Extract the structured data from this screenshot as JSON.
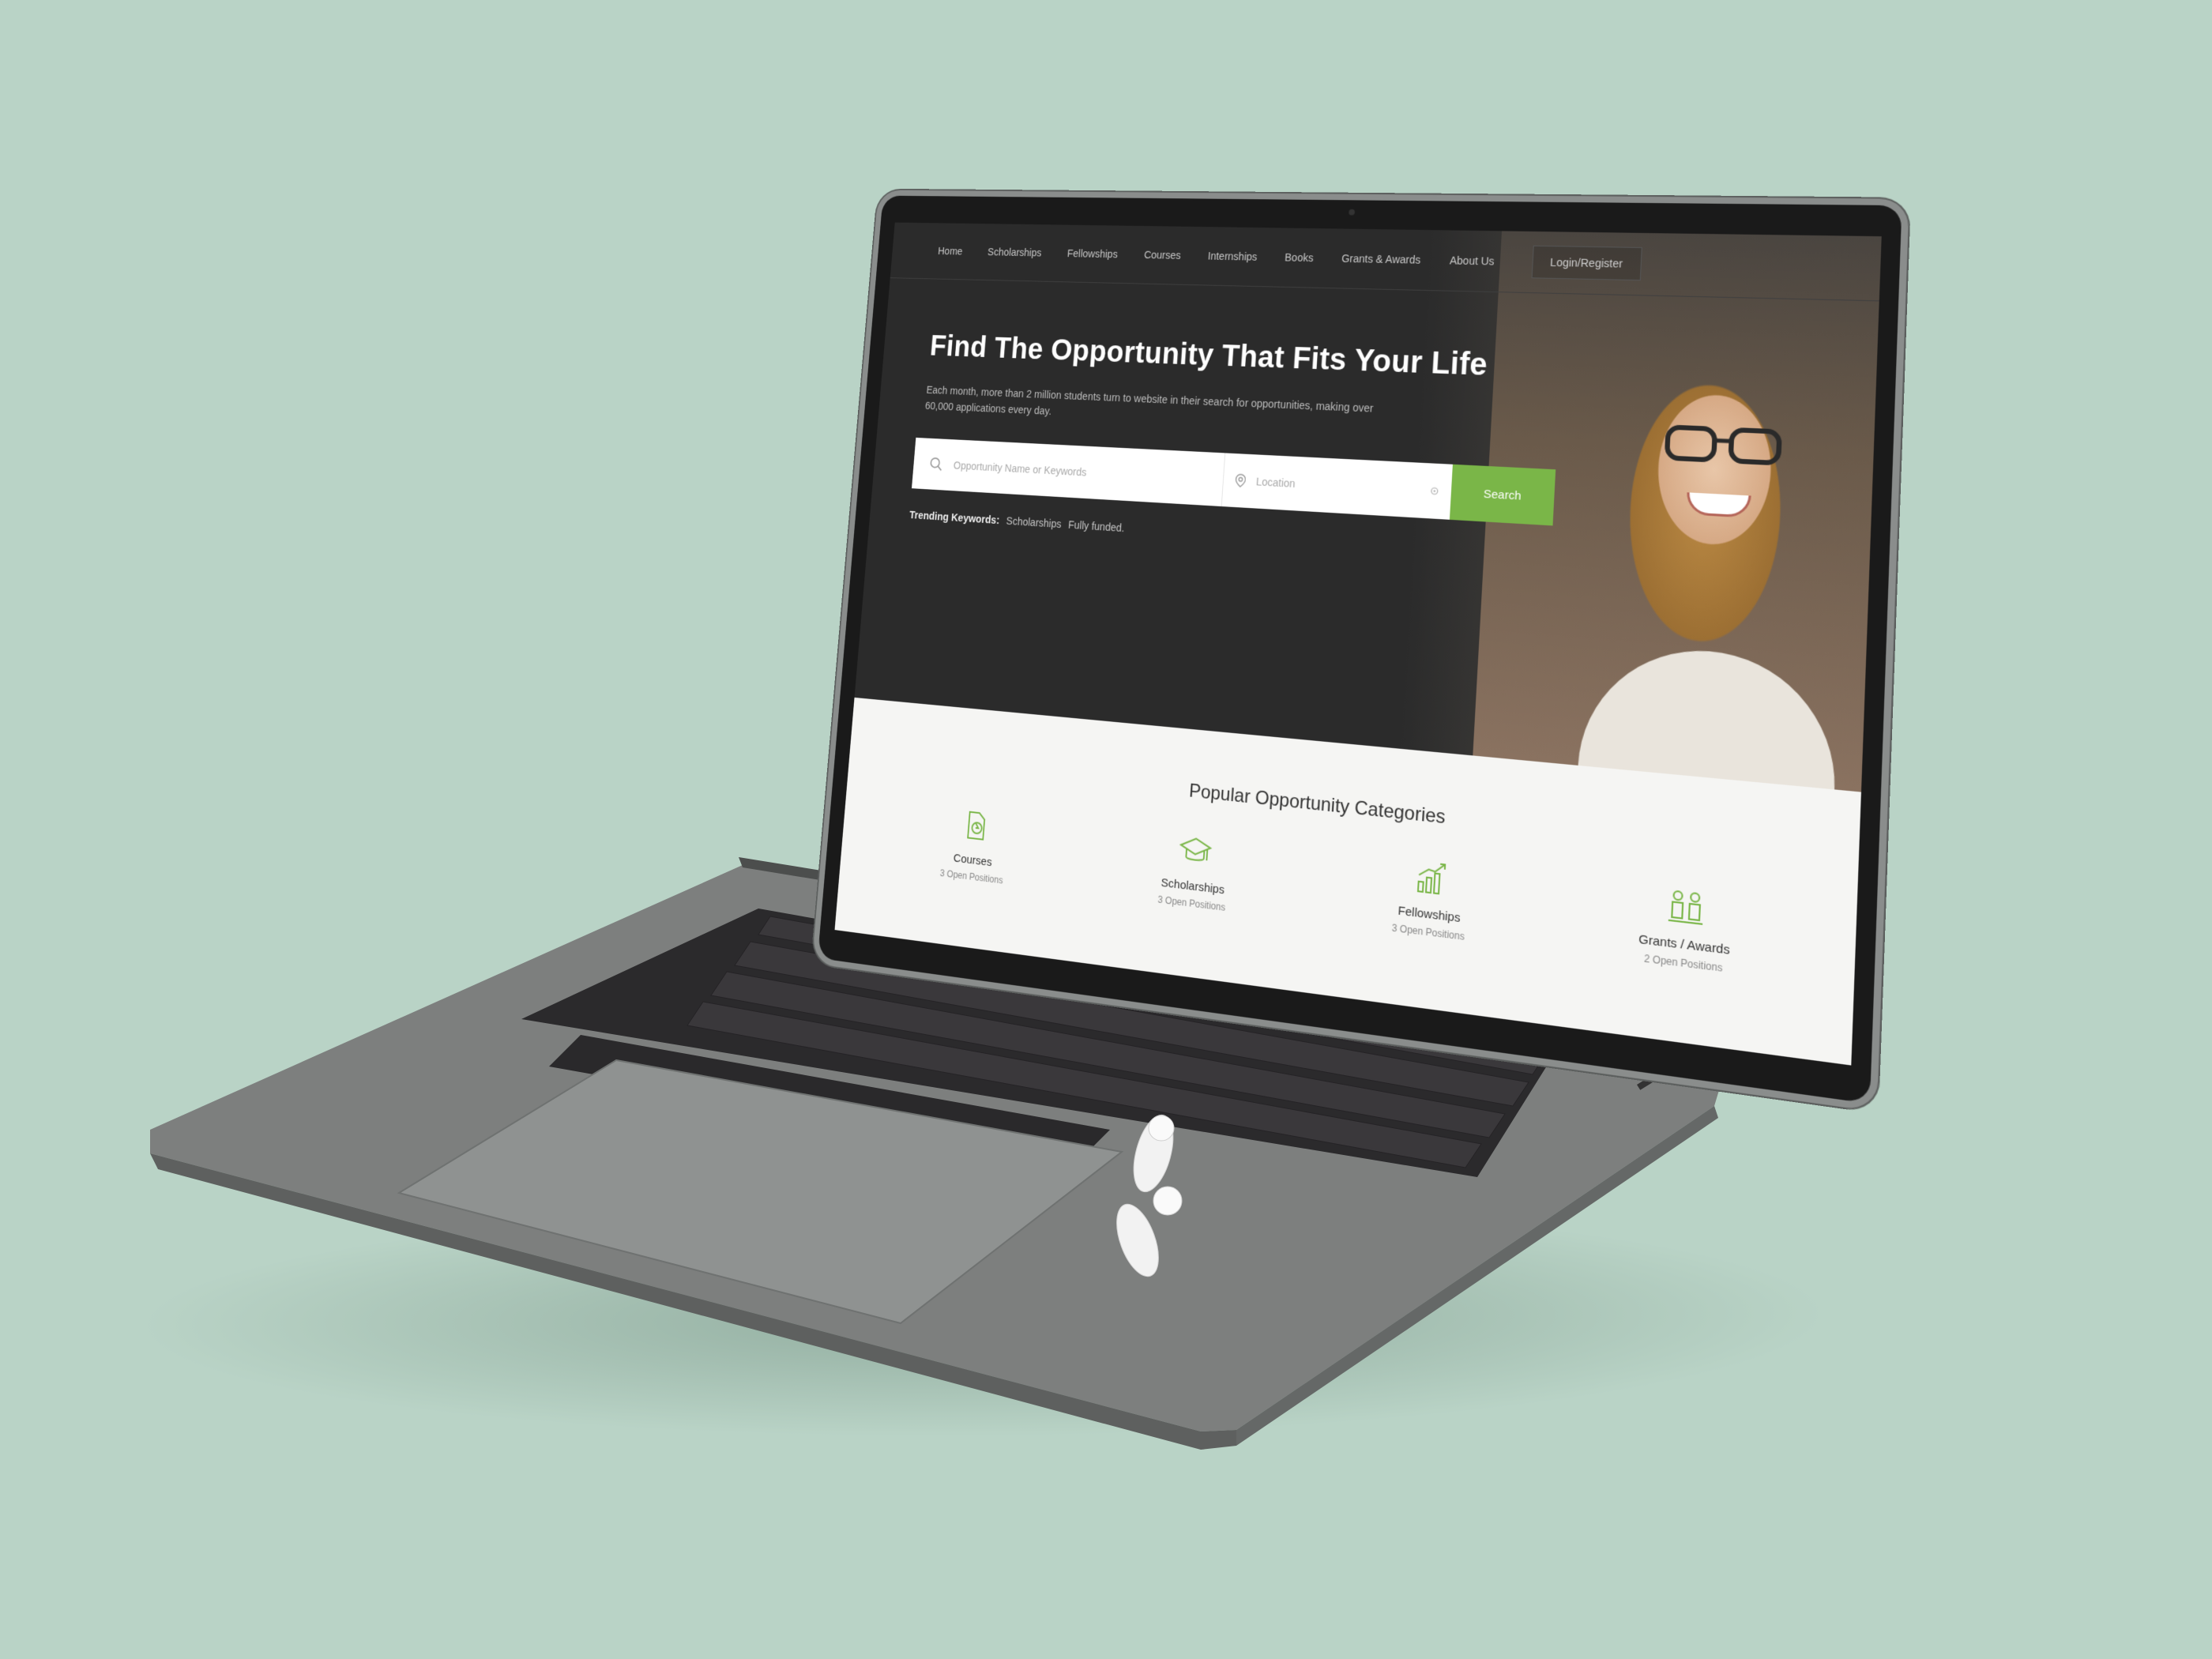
{
  "nav": {
    "items": [
      "Home",
      "Scholarships",
      "Fellowships",
      "Courses",
      "Internships",
      "Books",
      "Grants & Awards",
      "About Us"
    ],
    "login_label": "Login/Register"
  },
  "hero": {
    "title": "Find The Opportunity That Fits Your Life",
    "subtitle": "Each month, more than 2 million students turn to website in their search for opportunities, making over 60,000 applications every day."
  },
  "search": {
    "keyword_placeholder": "Opportunity Name or Keywords",
    "location_placeholder": "Location",
    "button_label": "Search"
  },
  "trending": {
    "label": "Trending Keywords:",
    "keywords": [
      "Scholarships",
      "Fully funded."
    ]
  },
  "categories": {
    "title": "Popular Opportunity Categories",
    "items": [
      {
        "name": "Courses",
        "count": "3 Open Positions",
        "icon": "courses-icon"
      },
      {
        "name": "Scholarships",
        "count": "3 Open Positions",
        "icon": "graduation-cap-icon"
      },
      {
        "name": "Fellowships",
        "count": "3 Open Positions",
        "icon": "growth-chart-icon"
      },
      {
        "name": "Grants / Awards",
        "count": "2 Open Positions",
        "icon": "grants-icon"
      }
    ]
  },
  "colors": {
    "accent": "#7ab648",
    "hero_bg": "#2b2b2b",
    "background": "#b9d3c6"
  }
}
